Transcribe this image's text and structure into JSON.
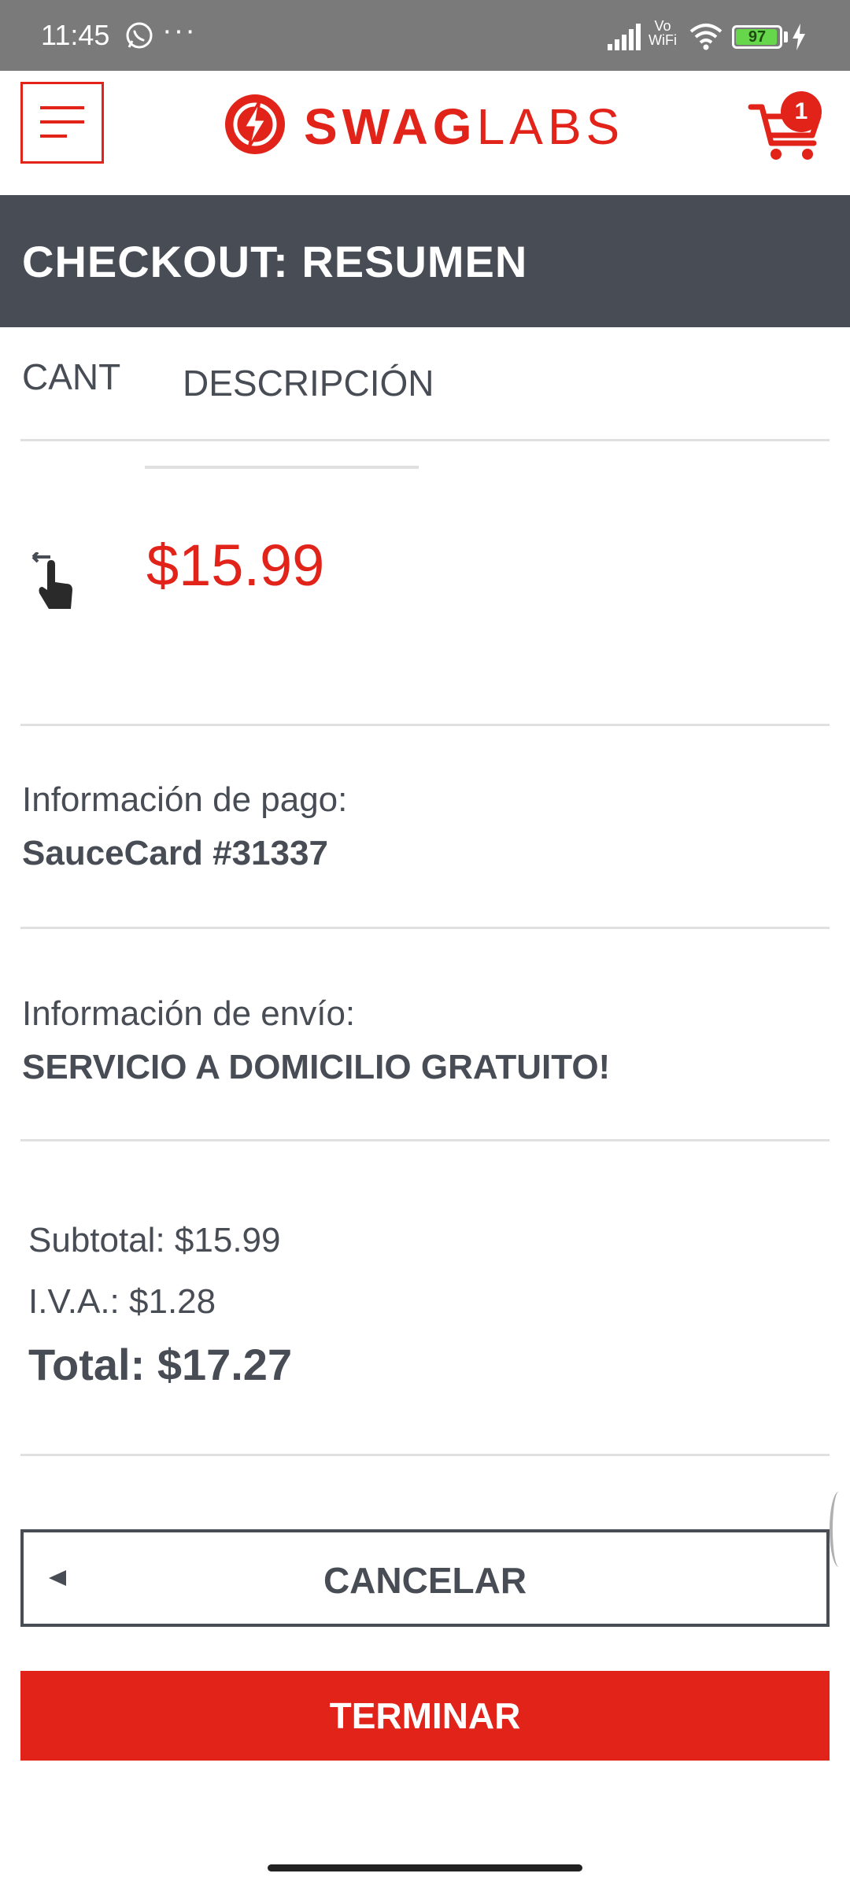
{
  "status_bar": {
    "time": "11:45",
    "more": "···",
    "vowifi_top": "Vo",
    "vowifi_bottom": "WiFi",
    "battery_level": "97",
    "battery_fraction": 0.97,
    "icons": [
      "whatsapp-icon",
      "signal-icon",
      "wifi-icon",
      "battery-icon",
      "charging-icon"
    ]
  },
  "header": {
    "logo_bold": "SWAG",
    "logo_light": "LABS",
    "cart_count": "1",
    "icons": [
      "menu-icon",
      "bolt-logo-icon",
      "cart-icon"
    ]
  },
  "title": "CHECKOUT: RESUMEN",
  "columns": {
    "quantity": "CANT",
    "description": "DESCRIPCIÓN"
  },
  "item": {
    "price": "$15.99",
    "icon": "drag-hand-icon"
  },
  "payment": {
    "label": "Información de pago:",
    "value": "SauceCard #31337"
  },
  "shipping": {
    "label": "Información de envío:",
    "value": "SERVICIO A DOMICILIO GRATUITO!"
  },
  "summary": {
    "subtotal": "Subtotal: $15.99",
    "tax": "I.V.A.: $1.28",
    "total": "Total: $17.27"
  },
  "buttons": {
    "cancel": "CANCELAR",
    "finish": "TERMINAR"
  },
  "colors": {
    "brand_red": "#e2231a",
    "dark_gray": "#474c55",
    "status_bar": "#7a7a7a"
  }
}
